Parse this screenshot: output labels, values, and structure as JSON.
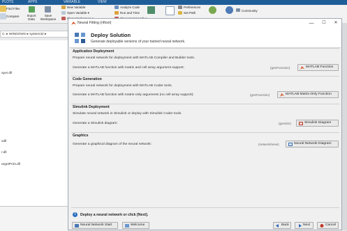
{
  "desktop": {
    "tabs": [
      "PLOTS",
      "APPS",
      "VARIABLE",
      "VIEW"
    ],
    "ribbon": {
      "find_files": "Find Files",
      "compare": "Compare",
      "import_data": "Import Data",
      "save_workspace": "Save Workspace",
      "new_variable": "New Variable",
      "open_variable": "Open Variable ▾",
      "clear_workspace": "Clear Workspace ▾",
      "analyze_code": "Analyze Code",
      "run_and_time": "Run and Time",
      "clear_commands": "Clear Commands ▾",
      "preferences": "Preferences",
      "set_path": "Set Path",
      "community": "Community"
    },
    "address": "C: ▸ WINDOWS ▸ system32 ▸",
    "files": [
      "ayer.dll",
      "xdll",
      "r.dll",
      "argetPrint.dll"
    ]
  },
  "window": {
    "title": "Neural Fitting (nftool)",
    "controls": {
      "minimize": "—",
      "maximize": "☐",
      "close": "✕"
    }
  },
  "header": {
    "title": "Deploy Solution",
    "subtitle": "Generate deployable versions of your trained neural network."
  },
  "sections": [
    {
      "title": "Application Deployment",
      "description": "Prepare neural network for deployment with MATLAB Compiler and Builder tools.",
      "action": "Generate a MATLAB function with matrix and cell array argument support:",
      "fn": "(genFunction)",
      "button": "MATLAB Function"
    },
    {
      "title": "Code Generation",
      "description": "Prepare neural network for deployment with MATLAB Coder tools.",
      "action": "Generate a MATLAB function with matrix-only arguments (no cell array support):",
      "fn": "(genFunction)",
      "button": "MATLAB Matrix-Only Function"
    },
    {
      "title": "Simulink Deployment",
      "description": "Simulate neural network in Simulink or deploy with Simulink Coder tools.",
      "action": "Generate a Simulink diagram:",
      "fn": "(gensim)",
      "button": "Simulink Diagram"
    },
    {
      "title": "Graphics",
      "description": "",
      "action": "Generate a graphical diagram of the neural network:",
      "fn": "(network/view)",
      "button": "Neural Network Diagram"
    }
  ],
  "info": "Deploy a neural network or click [Next].",
  "nav": {
    "start": "Neural Network Start",
    "welcome": "Welcome",
    "back": "Back",
    "next": "Next",
    "cancel": "Cancel"
  },
  "colors": {
    "accent": "#1f5d98",
    "panel": "#f0f0f0",
    "info": "#2c6fbf"
  }
}
